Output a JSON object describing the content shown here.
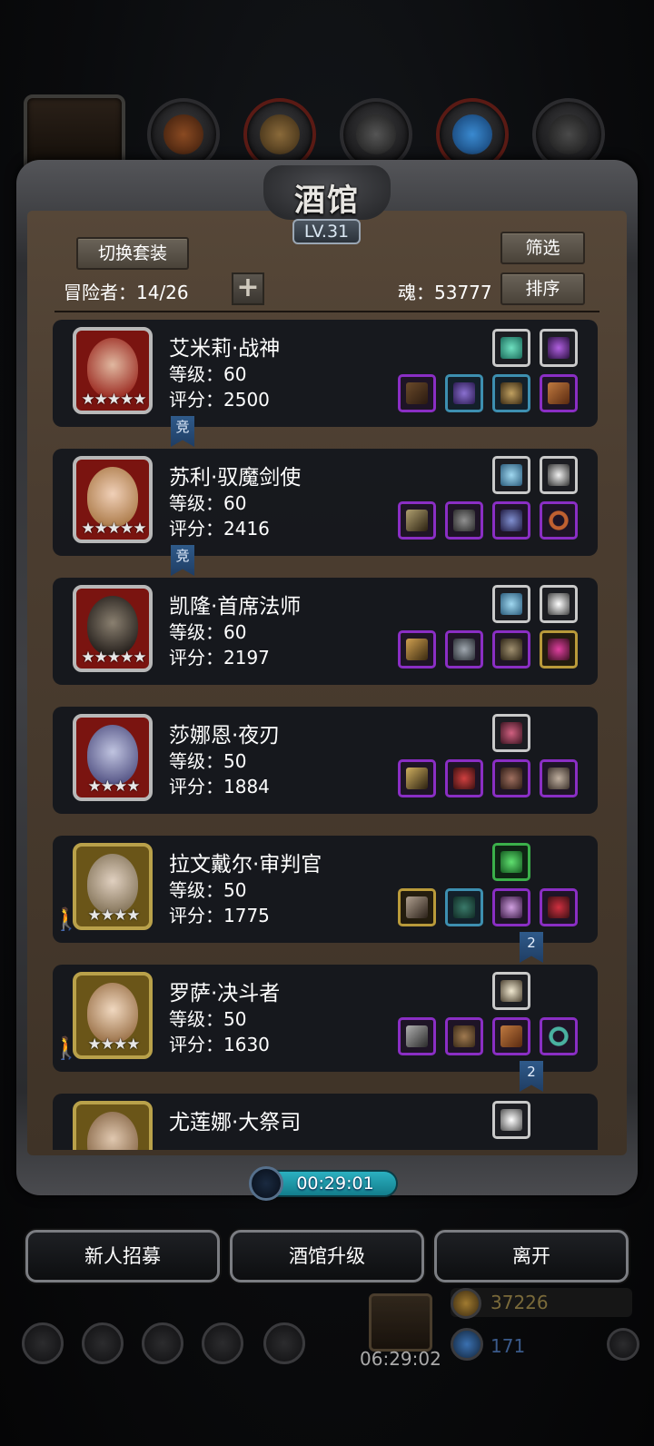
{
  "title": "酒馆",
  "level_badge": "LV.31",
  "buttons": {
    "switch_outfit": "切换套装",
    "filter": "筛选",
    "sort": "排序",
    "plus": "+"
  },
  "adventurer_count": "冒险者：14/26",
  "soul": "魂：53777",
  "heroes": [
    {
      "name": "艾米莉·战神",
      "level": "等级：60",
      "score": "评分：2500",
      "stars": "★★★★★",
      "ribbon": "竞"
    },
    {
      "name": "苏利·驭魔剑使",
      "level": "等级：60",
      "score": "评分：2416",
      "stars": "★★★★★",
      "ribbon": "竞"
    },
    {
      "name": "凯隆·首席法师",
      "level": "等级：60",
      "score": "评分：2197",
      "stars": "★★★★★"
    },
    {
      "name": "莎娜恩·夜刃",
      "level": "等级：50",
      "score": "评分：1884",
      "stars": "★★★★"
    },
    {
      "name": "拉文戴尔·审判官",
      "level": "等级：50",
      "score": "评分：1775",
      "stars": "★★★★",
      "ribbon": "2"
    },
    {
      "name": "罗萨·决斗者",
      "level": "等级：50",
      "score": "评分：1630",
      "stars": "★★★★",
      "ribbon": "2"
    },
    {
      "name": "尤莲娜·大祭司"
    }
  ],
  "timer": "00:29:01",
  "actions": {
    "recruit": "新人招募",
    "upgrade": "酒馆升级",
    "leave": "离开"
  },
  "hud": {
    "gift_timer": "06:29:02",
    "gold": "37226",
    "gems": "171"
  }
}
